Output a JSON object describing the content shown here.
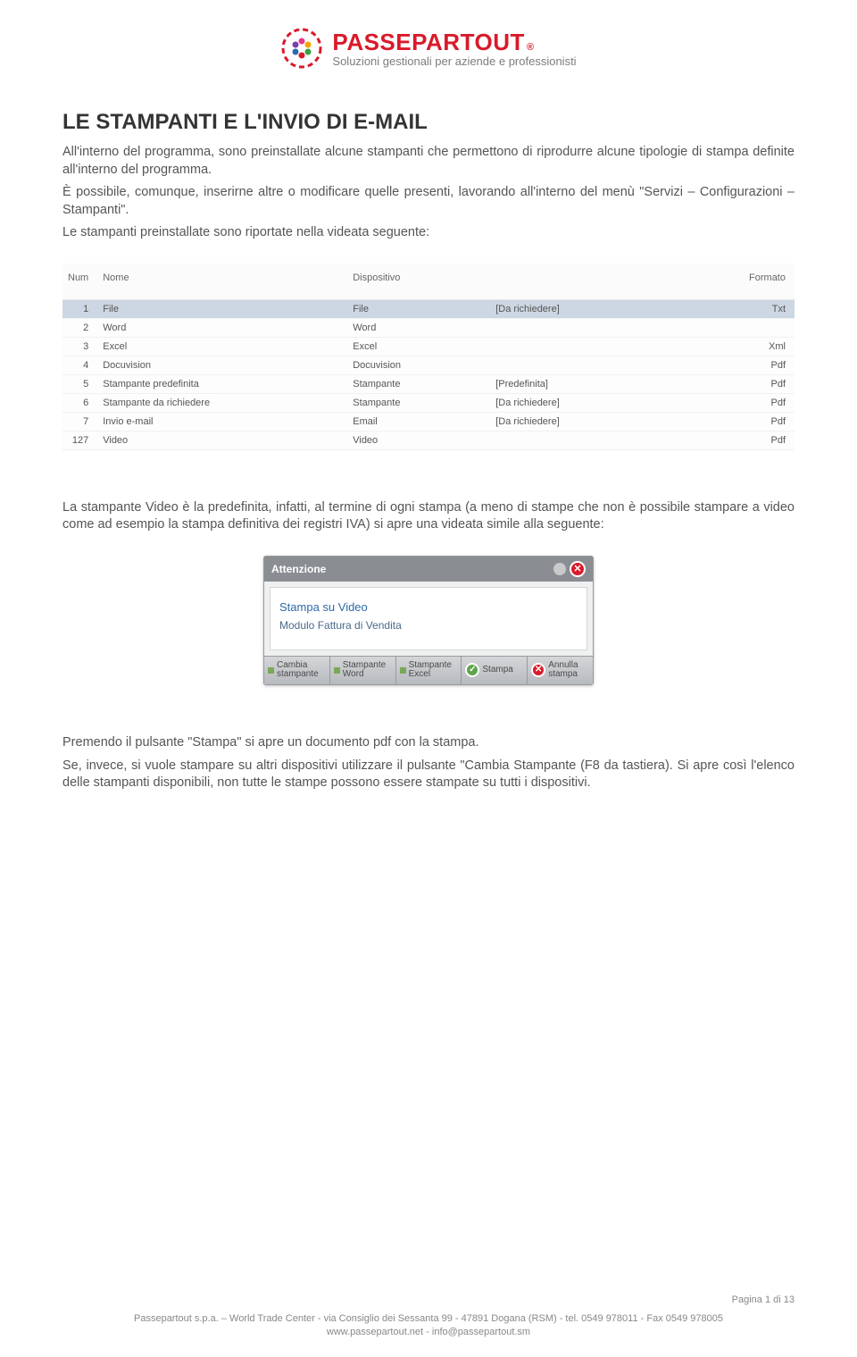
{
  "brand": {
    "name": "PASSEPARTOUT",
    "reg": "®",
    "tagline": "Soluzioni gestionali per aziende e professionisti"
  },
  "title": "LE STAMPANTI E L'INVIO DI E-MAIL",
  "paragraphs": {
    "p1": "All'interno del programma, sono preinstallate alcune stampanti che permettono di riprodurre alcune tipologie di stampa definite all'interno del programma.",
    "p2": "È possibile, comunque, inserirne altre o modificare quelle presenti, lavorando all'interno del menù \"Servizi – Configurazioni – Stampanti\".",
    "p3": "Le stampanti preinstallate sono riportate nella videata seguente:",
    "p4": "La stampante Video è la predefinita, infatti, al termine di ogni stampa (a meno di stampe che non è possibile stampare a video come ad esempio la stampa definitiva dei registri IVA) si apre una videata simile alla seguente:",
    "p5": "Premendo il pulsante \"Stampa\" si apre un documento pdf con la stampa.",
    "p6": "Se, invece, si vuole stampare su altri dispositivi utilizzare il pulsante \"Cambia Stampante (F8 da tastiera). Si apre così l'elenco delle stampanti disponibili, non tutte le stampe possono essere stampate su tutti i dispositivi."
  },
  "table": {
    "headers": {
      "num": "Num",
      "nome": "Nome",
      "disp": "Dispositivo",
      "opt": "",
      "fmt": "Formato"
    },
    "rows": [
      {
        "num": "1",
        "nome": "File",
        "disp": "File",
        "opt": "[Da richiedere]",
        "fmt": "Txt",
        "selected": true
      },
      {
        "num": "2",
        "nome": "Word",
        "disp": "Word",
        "opt": "",
        "fmt": ""
      },
      {
        "num": "3",
        "nome": "Excel",
        "disp": "Excel",
        "opt": "",
        "fmt": "Xml"
      },
      {
        "num": "4",
        "nome": "Docuvision",
        "disp": "Docuvision",
        "opt": "",
        "fmt": "Pdf"
      },
      {
        "num": "5",
        "nome": "Stampante predefinita",
        "disp": "Stampante",
        "opt": "[Predefinita]",
        "fmt": "Pdf"
      },
      {
        "num": "6",
        "nome": "Stampante da richiedere",
        "disp": "Stampante",
        "opt": "[Da richiedere]",
        "fmt": "Pdf"
      },
      {
        "num": "7",
        "nome": "Invio e-mail",
        "disp": "Email",
        "opt": "[Da richiedere]",
        "fmt": "Pdf"
      },
      {
        "num": "127",
        "nome": "Video",
        "disp": "Video",
        "opt": "",
        "fmt": "Pdf"
      }
    ]
  },
  "dialog": {
    "title": "Attenzione",
    "line1": "Stampa su Video",
    "line2": "Modulo Fattura di Vendita",
    "buttons": {
      "b1": "Cambia stampante",
      "b2": "Stampante Word",
      "b3": "Stampante Excel",
      "b4": "Stampa",
      "b5": "Annulla stampa"
    }
  },
  "footer": {
    "page": "Pagina 1 di 13",
    "line1": "Passepartout s.p.a. – World Trade Center - via Consiglio dei Sessanta 99 - 47891 Dogana (RSM) - tel. 0549 978011 - Fax 0549 978005",
    "line2": "www.passepartout.net - info@passepartout.sm"
  }
}
